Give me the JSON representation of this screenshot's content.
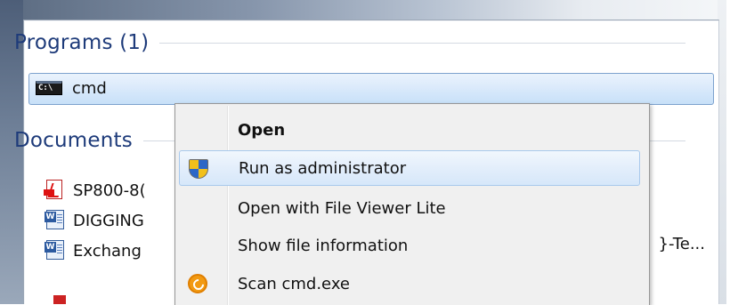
{
  "search_results": {
    "programs": {
      "header": "Programs (1)",
      "items": [
        {
          "label": "cmd",
          "icon": "command-prompt-icon",
          "selected": true
        }
      ]
    },
    "documents": {
      "header": "Documents",
      "items": [
        {
          "label": "SP800-8(",
          "icon": "pdf-icon"
        },
        {
          "label": "DIGGING",
          "icon": "word-document-icon"
        },
        {
          "label": "Exchang",
          "icon": "word-document-icon",
          "trailing_text": "}-Te..."
        }
      ]
    }
  },
  "cmd_icon_text": "C:\\",
  "context_menu": {
    "items": [
      {
        "label": "Open",
        "bold": true,
        "icon": null
      },
      {
        "label": "Run as administrator",
        "icon": "uac-shield-icon",
        "highlighted": true
      },
      {
        "label": "Open with File Viewer Lite",
        "icon": null
      },
      {
        "label": "Show file information",
        "icon": null
      },
      {
        "label": "Scan cmd.exe",
        "icon": "antivirus-scan-icon"
      }
    ]
  },
  "colors": {
    "header_text": "#1e3b7a",
    "selection_border": "#7da2ce",
    "menu_highlight_border": "#a9c9ec",
    "menu_background": "#f0f0f0"
  }
}
